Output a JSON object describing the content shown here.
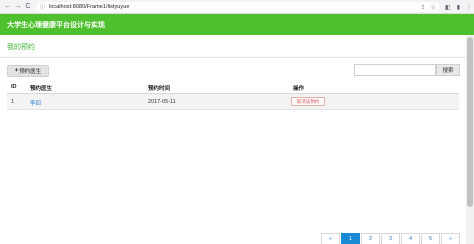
{
  "browser": {
    "url": "localhost:8080/Frame1/listyuyue",
    "back_icon": "←",
    "forward_icon": "→",
    "reload_icon": "C",
    "lock_icon": "ⓘ",
    "share_icon": "⇪",
    "star_icon": "☆",
    "extension_icon": "◧",
    "profile_icon": "▮",
    "menu_icon": "⋮"
  },
  "header": {
    "title": "大学生心理健康平台设计与实现"
  },
  "page": {
    "title": "我的预约"
  },
  "toolbar": {
    "add_icon": "+",
    "add_label": "预约医生",
    "search_placeholder": "",
    "search_label": "搜索"
  },
  "table": {
    "columns": [
      "ID",
      "预约医生",
      "预约时间",
      "操作"
    ],
    "rows": [
      {
        "id": "1",
        "doctor": "李四",
        "time": "2017-05-11",
        "action": "取消该预约"
      }
    ]
  },
  "pagination": {
    "prev": "«",
    "pages": [
      "1",
      "2",
      "3",
      "4",
      "5"
    ],
    "active": "1",
    "next": "»"
  },
  "colors": {
    "header": "#4ec02e",
    "title": "#3cb535",
    "link": "#2e7bcf",
    "active_page": "#1a8ad6"
  }
}
